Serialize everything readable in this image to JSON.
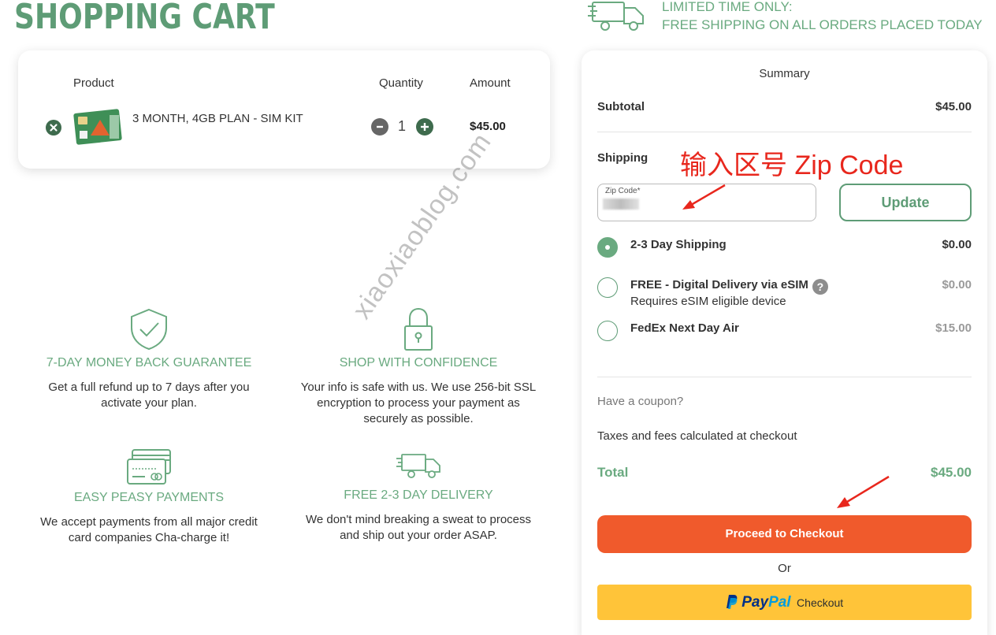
{
  "page": {
    "title": "SHOPPING CART"
  },
  "promo": {
    "line1": "LIMITED TIME ONLY:",
    "line2": "FREE SHIPPING ON ALL ORDERS PLACED TODAY",
    "icon": "delivery-truck-icon"
  },
  "cart": {
    "columns": {
      "product": "Product",
      "quantity": "Quantity",
      "amount": "Amount"
    },
    "items": [
      {
        "name": "3 MONTH, 4GB PLAN - SIM KIT",
        "quantity": "1",
        "amount": "$45.00"
      }
    ]
  },
  "features": [
    {
      "icon": "shield-check-icon",
      "title": "7-DAY MONEY BACK GUARANTEE",
      "desc": "Get a full refund up to 7 days after you activate your plan."
    },
    {
      "icon": "padlock-icon",
      "title": "SHOP WITH CONFIDENCE",
      "desc": "Your info is safe with us. We use 256-bit SSL encryption to process your payment as securely as possible."
    },
    {
      "icon": "credit-cards-icon",
      "title": "EASY PEASY PAYMENTS",
      "desc": "We accept payments from all major credit card companies Cha-charge it!"
    },
    {
      "icon": "delivery-truck-icon",
      "title": "FREE 2-3 DAY DELIVERY",
      "desc": "We don't mind breaking a sweat to process and ship out your order ASAP."
    }
  ],
  "summary": {
    "title": "Summary",
    "subtotal_label": "Subtotal",
    "subtotal_value": "$45.00",
    "shipping_label": "Shipping",
    "zip_label": "Zip Code*",
    "zip_value": "",
    "update_label": "Update",
    "shipping_options": [
      {
        "name": "2-3 Day Shipping",
        "sub": "",
        "price": "$0.00",
        "selected": true
      },
      {
        "name": "FREE - Digital Delivery via eSIM",
        "sub": "Requires eSIM eligible device",
        "price": "$0.00",
        "selected": false,
        "help": "?"
      },
      {
        "name": "FedEx Next Day Air",
        "sub": "",
        "price": "$15.00",
        "selected": false
      }
    ],
    "coupon_label": "Have a coupon?",
    "tax_note": "Taxes and fees calculated at checkout",
    "total_label": "Total",
    "total_value": "$45.00",
    "checkout_label": "Proceed to Checkout",
    "or_label": "Or",
    "paypal": {
      "pay": "Pay",
      "pal": "Pal",
      "checkout": "Checkout"
    }
  },
  "annotation": {
    "text": "输入区号 Zip Code"
  },
  "watermark": {
    "text": "xiaoxiaoblog.com"
  },
  "colors": {
    "brand_green": "#5e9c76",
    "light_green": "#6aaa80",
    "checkout_orange": "#f05a2c",
    "paypal_yellow": "#ffc439",
    "annotation_red": "#e8271d"
  }
}
